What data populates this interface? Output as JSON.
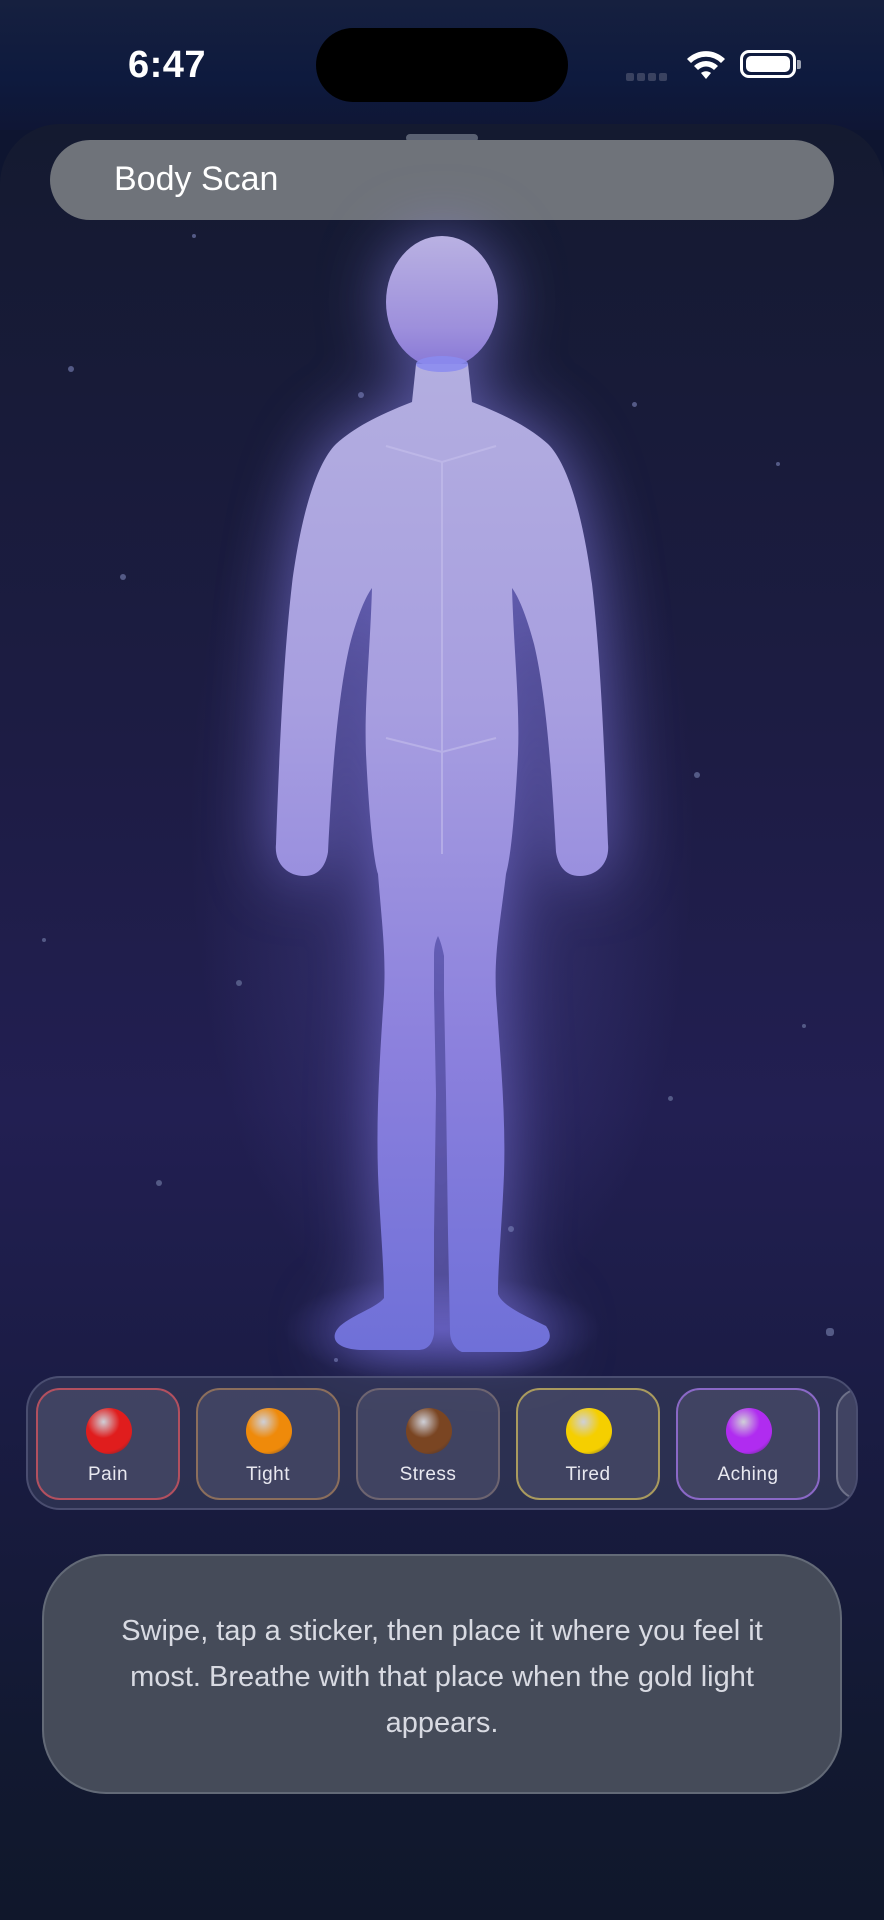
{
  "status_bar": {
    "time": "6:47"
  },
  "header": {
    "title": "Body Scan"
  },
  "stickers": [
    {
      "label": "Pain",
      "color": "#e01d1d",
      "border": "#b2505f"
    },
    {
      "label": "Tight",
      "color": "#ef8a0a",
      "border": "#8b6e5c"
    },
    {
      "label": "Stress",
      "color": "#7a4522",
      "border": "#6d6470"
    },
    {
      "label": "Tired",
      "color": "#f5cf00",
      "border": "#a99a5e"
    },
    {
      "label": "Aching",
      "color": "#b02cf0",
      "border": "#8a68c6"
    }
  ],
  "hint": {
    "text": "Swipe, tap a sticker, then place it where you feel it most. Breathe with that place when the gold light appears."
  },
  "colors": {
    "accent": "#8b7fe0",
    "background": "#10172b"
  }
}
